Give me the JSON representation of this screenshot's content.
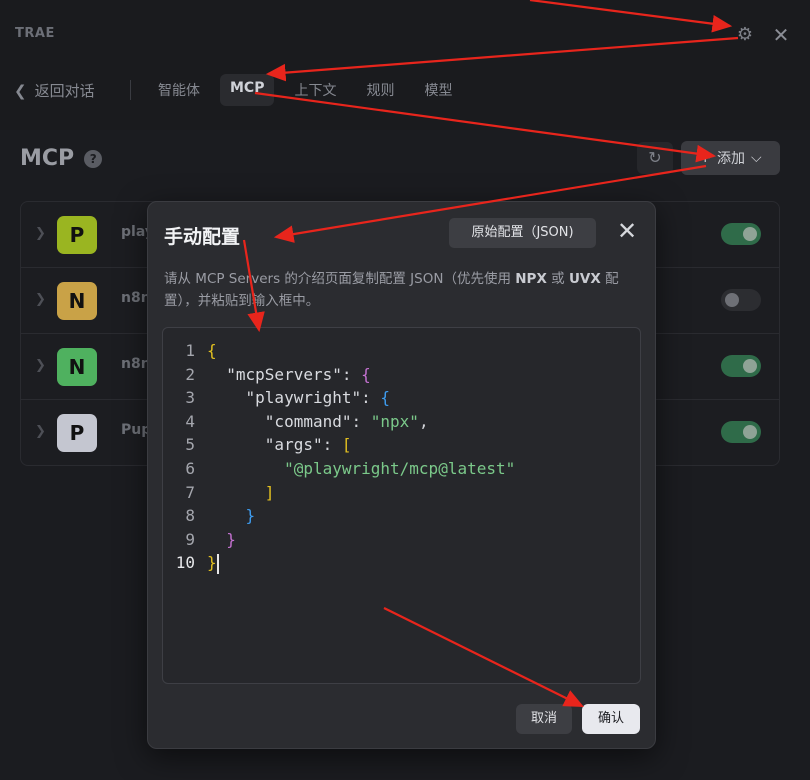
{
  "header": {
    "app_title": "TRAE",
    "back_label": "返回对话",
    "tabs": [
      {
        "label": "智能体",
        "active": false
      },
      {
        "label": "MCP",
        "active": true
      },
      {
        "label": "上下文",
        "active": false
      },
      {
        "label": "规则",
        "active": false
      },
      {
        "label": "模型",
        "active": false
      }
    ]
  },
  "mcp_page": {
    "title": "MCP",
    "help": "?",
    "add_label": "添加",
    "servers": [
      {
        "letter": "P",
        "name": "play",
        "color": "#9ab521",
        "enabled": true
      },
      {
        "letter": "N",
        "name": "n8n",
        "color": "#c9a247",
        "enabled": false
      },
      {
        "letter": "N",
        "name": "n8n",
        "color": "#4fb15f",
        "enabled": true
      },
      {
        "letter": "P",
        "name": "Pup",
        "color": "#c4c6d0",
        "enabled": true
      }
    ]
  },
  "dialog": {
    "title": "手动配置",
    "raw_config_label": "原始配置（JSON)",
    "description_parts": {
      "p1": "请从 MCP Servers 的介绍页面复制配置 JSON（优先使用 ",
      "npx": "NPX",
      "or": " 或 ",
      "uvx": "UVX",
      "p2": " 配置），并粘贴到输入框中。"
    },
    "line_numbers": [
      "1",
      "2",
      "3",
      "4",
      "5",
      "6",
      "7",
      "8",
      "9",
      "10"
    ],
    "code": {
      "mcpServers": "\"mcpServers\"",
      "playwright": "\"playwright\"",
      "command_key": "\"command\"",
      "command_val": "\"npx\"",
      "args_key": "\"args\"",
      "args_val": "\"@playwright/mcp@latest\""
    },
    "cancel_label": "取消",
    "confirm_label": "确认"
  },
  "colors": {
    "annotation_arrow": "#e8251c",
    "json_string": "#7bc98a",
    "brace_level_1": "#e2c020",
    "brace_level_2": "#c471d1",
    "brace_level_3": "#3e9cef"
  }
}
